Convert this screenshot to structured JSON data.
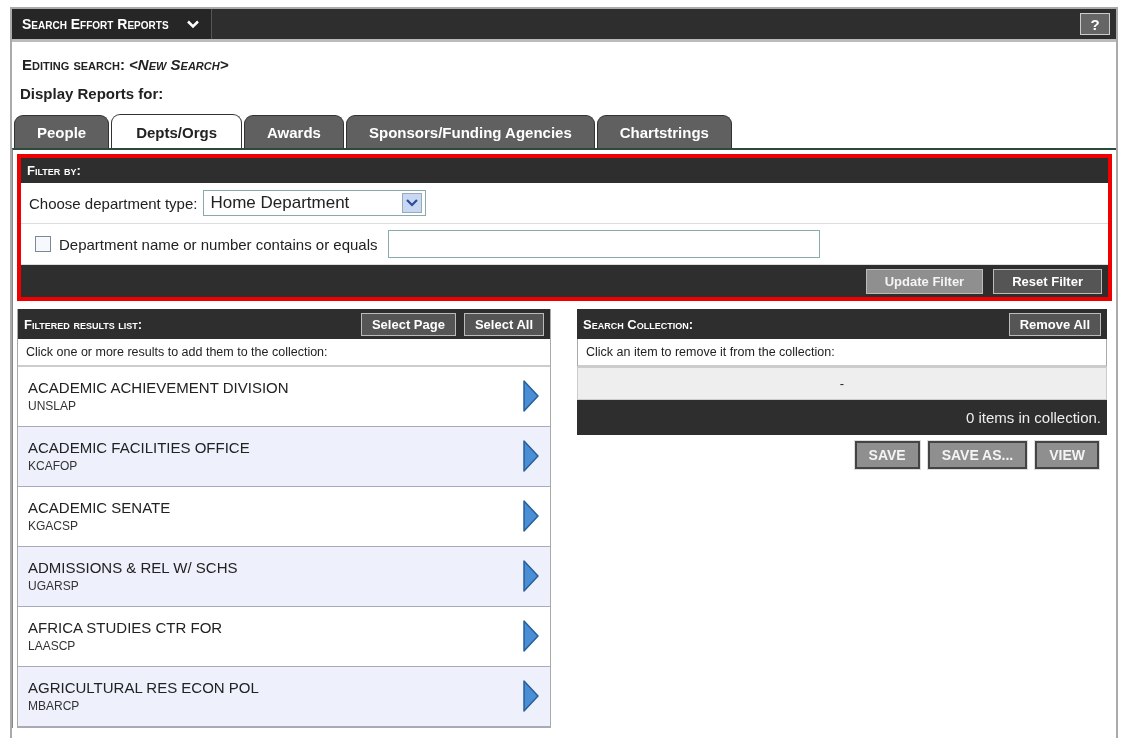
{
  "header": {
    "title": "Search Effort Reports",
    "help": "?"
  },
  "editing": "Editing search: *<New Search>*",
  "display_label": "Display Reports for:",
  "tabs": [
    {
      "label": "People",
      "selected": false
    },
    {
      "label": "Depts/Orgs",
      "selected": true
    },
    {
      "label": "Awards",
      "selected": false
    },
    {
      "label": "Sponsors/Funding Agencies",
      "selected": false
    },
    {
      "label": "Chartstrings",
      "selected": false
    }
  ],
  "filter": {
    "title": "Filter by:",
    "type_label": "Choose department type:",
    "type_value": "Home Department",
    "name_label": "Department name or number contains or equals",
    "name_checked": false,
    "buttons": [
      {
        "label": "Update Filter",
        "disabled": true
      },
      {
        "label": "Reset Filter",
        "disabled": false
      }
    ]
  },
  "results": {
    "title": "Filtered results list:",
    "buttons": [
      "Select Page",
      "Select All"
    ],
    "hint": "Click one or more results to add them to the collection:",
    "items": [
      {
        "name": "ACADEMIC ACHIEVEMENT DIVISION",
        "code": "UNSLAP"
      },
      {
        "name": "ACADEMIC FACILITIES OFFICE",
        "code": "KCAFOP"
      },
      {
        "name": "ACADEMIC SENATE",
        "code": "KGACSP"
      },
      {
        "name": "ADMISSIONS & REL W/ SCHS",
        "code": "UGARSP"
      },
      {
        "name": "AFRICA STUDIES CTR FOR",
        "code": "LAASCP"
      },
      {
        "name": "AGRICULTURAL RES ECON POL",
        "code": "MBARCP"
      }
    ]
  },
  "collection": {
    "title": "Search Collection:",
    "button": "Remove All",
    "hint": "Click an item to remove it from the collection:",
    "empty": "-",
    "count": "0 items in collection.",
    "buttons": [
      {
        "label": "SAVE",
        "disabled": true
      },
      {
        "label": "SAVE AS...",
        "disabled": true
      },
      {
        "label": "VIEW",
        "disabled": true
      }
    ]
  }
}
